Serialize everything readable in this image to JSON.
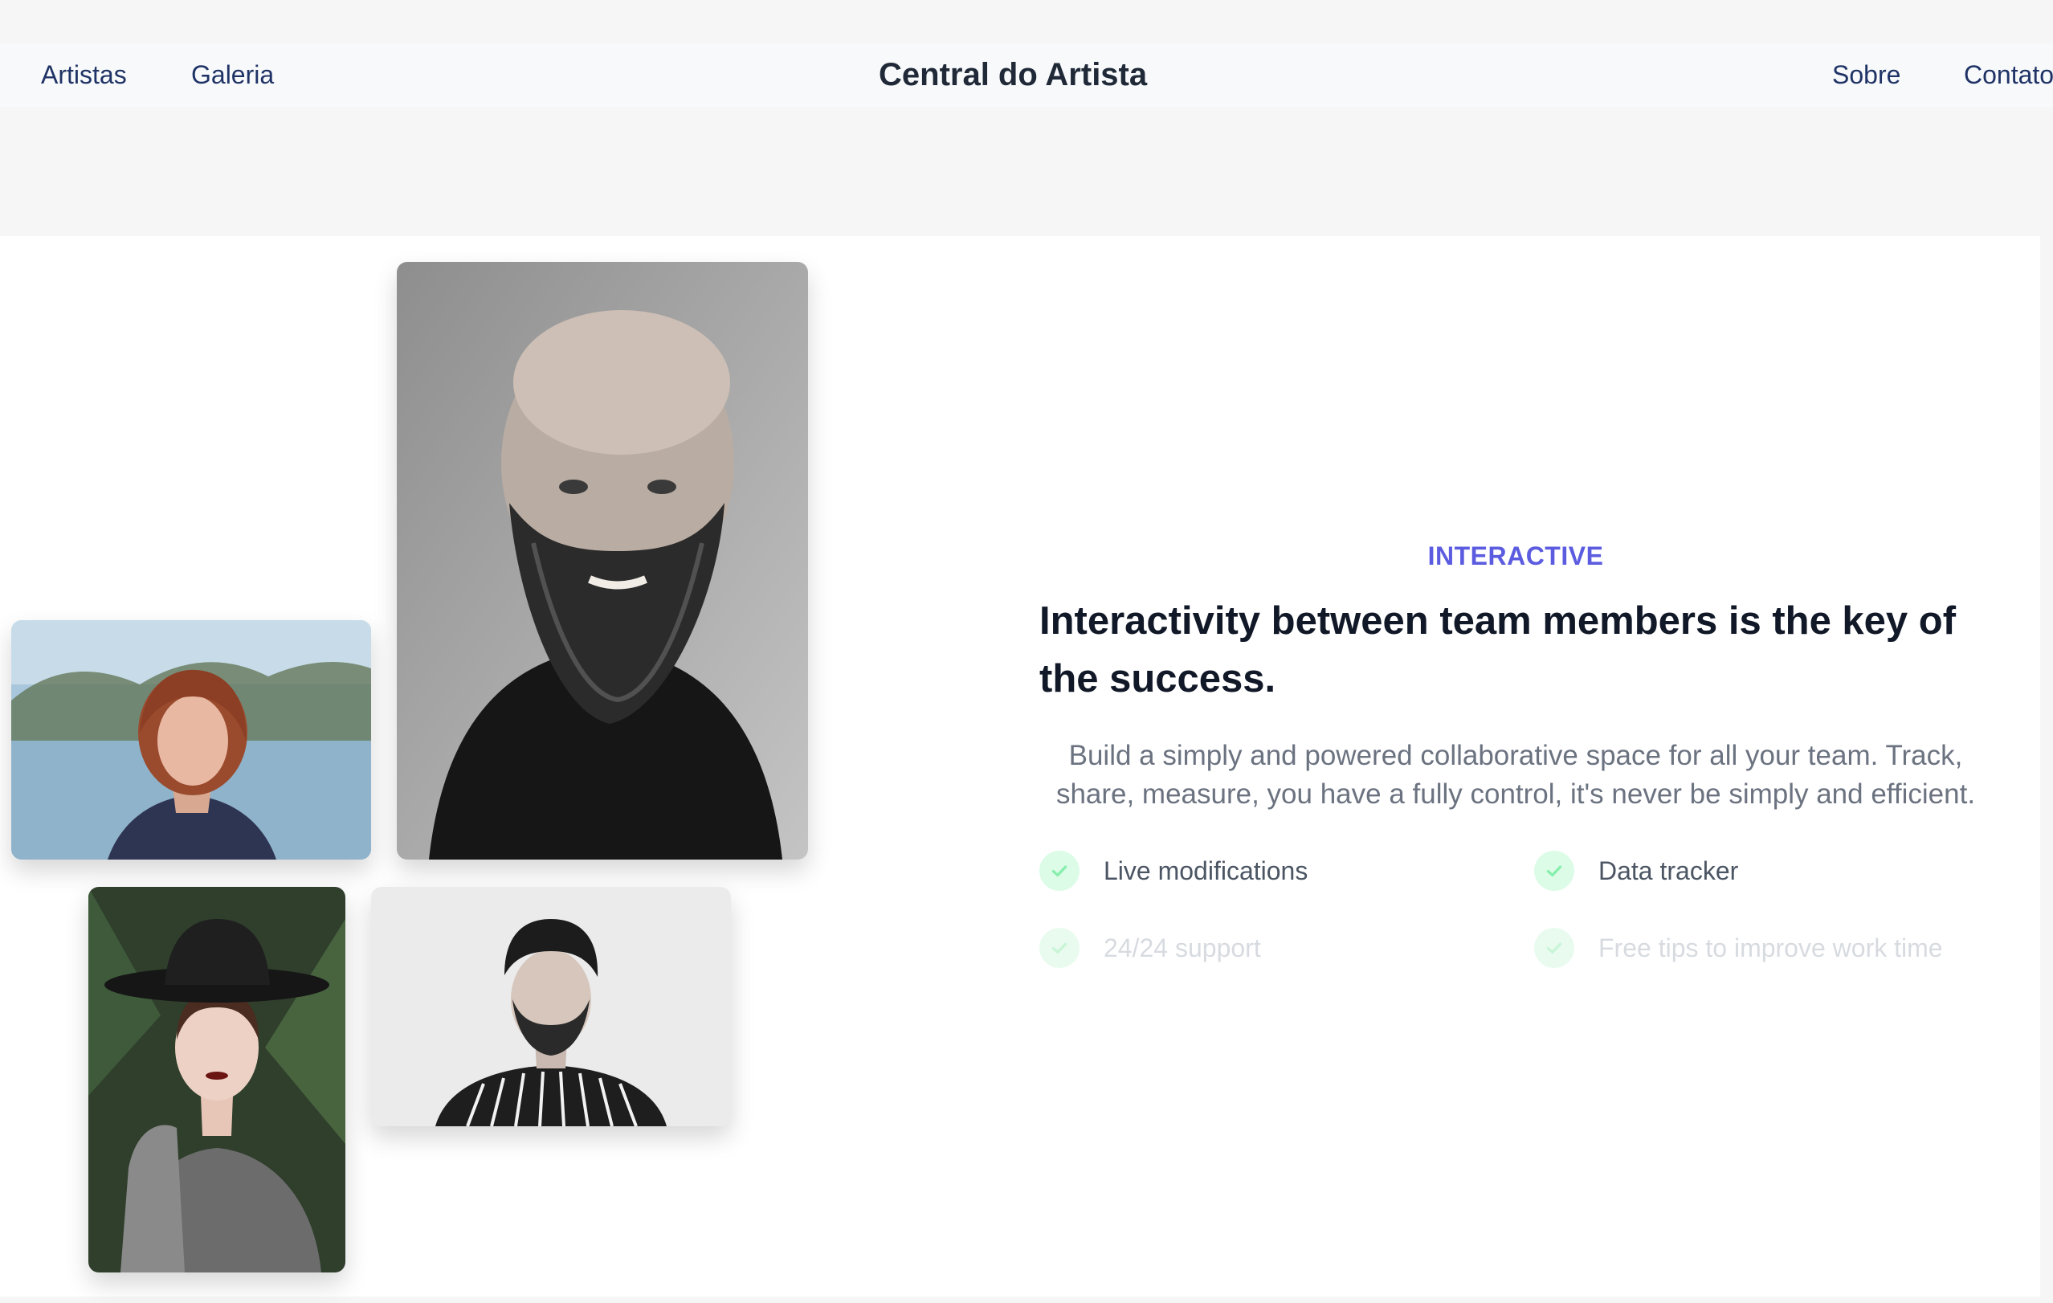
{
  "navbar": {
    "brand": "Central do Artista",
    "left_links": [
      {
        "label": "Artistas"
      },
      {
        "label": "Galeria"
      }
    ],
    "right_links": [
      {
        "label": "Sobre"
      },
      {
        "label": "Contato"
      }
    ]
  },
  "main": {
    "eyebrow": "INTERACTIVE",
    "heading": "Interactivity between team members is the key of the success.",
    "lead": "Build a simply and powered collaborative space for all your team. Track, share, measure, you have a fully control, it's never be simply and efficient.",
    "features": [
      {
        "label": "Live modifications",
        "icon": "check-icon"
      },
      {
        "label": "Data tracker",
        "icon": "check-icon"
      },
      {
        "label": "24/24 support",
        "icon": "check-icon"
      },
      {
        "label": "Free tips to improve work time",
        "icon": "check-icon"
      }
    ]
  },
  "colors": {
    "accent": "#5c5ce0",
    "nav_link": "#1f3366",
    "check_bg": "#dcfce7",
    "check_mark": "#86efac"
  }
}
